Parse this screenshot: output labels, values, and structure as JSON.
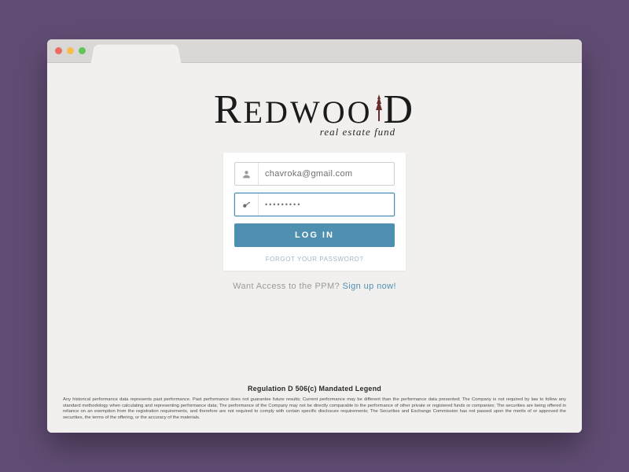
{
  "logo": {
    "main_pre": "R",
    "main_mid": "EDWOO",
    "main_post": "D",
    "sub": "real estate fund"
  },
  "form": {
    "email_value": "chavroka@gmail.com",
    "password_value": "•••••••••",
    "login_label": "LOG IN",
    "forgot_label": "FORGOT YOUR PASSWORD?"
  },
  "signup": {
    "prompt": "Want Access to the PPM? ",
    "link": "Sign up now!"
  },
  "legal": {
    "title": "Regulation D 506(c) Mandated Legend",
    "body": "Any historical performance data represents past performance.  Past performance does not guarantee future results; Current performance may be different than the performance data presented; The Company is not required by law to follow any standard methodology when calculating and representing performance data; The performance of the Company may not be directly comparable to the performance of other private or registered funds or companies; The securities are being offered in reliance on an exemption from the registration requirements, and therefore are not required to comply with certain specific disclosure requirements; The Securities and Exchange Commission has not passed upon the merits of or approved the securities, the terms of the offering, or the accuracy of the materials."
  }
}
